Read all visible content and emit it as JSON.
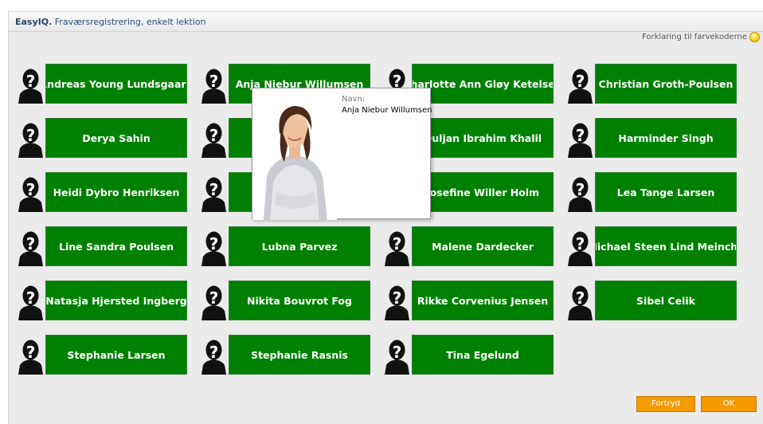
{
  "window": {
    "brand": "EasyIQ.",
    "subtitle": " Fraværsregistrering, enkelt lektion"
  },
  "legend": {
    "label": "Forklaring til farvekoderne",
    "icon": "lightbulb-icon"
  },
  "students": [
    {
      "name": "Andreas Young Lundsgaard"
    },
    {
      "name": "Anja Niebur Willumsen"
    },
    {
      "name": "Charlotte Ann Gløy Ketelsen"
    },
    {
      "name": "Christian Groth-Poulsen"
    },
    {
      "name": "Derya Sahin"
    },
    {
      "name": ""
    },
    {
      "name": "Duljan Ibrahim Khalil"
    },
    {
      "name": "Harminder Singh"
    },
    {
      "name": "Heidi Dybro Henriksen"
    },
    {
      "name": ""
    },
    {
      "name": "Josefine Willer Holm"
    },
    {
      "name": "Lea Tange Larsen"
    },
    {
      "name": "Line Sandra Poulsen"
    },
    {
      "name": "Lubna Parvez"
    },
    {
      "name": "Malene Dardecker"
    },
    {
      "name": "Michael Steen Lind Meinche"
    },
    {
      "name": "Natasja Hjersted Ingberg"
    },
    {
      "name": "Nikita Bouvrot Fog"
    },
    {
      "name": "Rikke Corvenius Jensen"
    },
    {
      "name": "Sibel Celik"
    },
    {
      "name": "Stephanie Larsen"
    },
    {
      "name": "Stephanie Rasnis"
    },
    {
      "name": "Tina Egelund"
    }
  ],
  "popup": {
    "label": "Navn:",
    "name": "Anja Niebur Willumsen"
  },
  "buttons": {
    "cancel": "Fortryd",
    "ok": "OK"
  },
  "colors": {
    "present": "#008000",
    "button": "#f59a00",
    "title": "#27426e"
  }
}
